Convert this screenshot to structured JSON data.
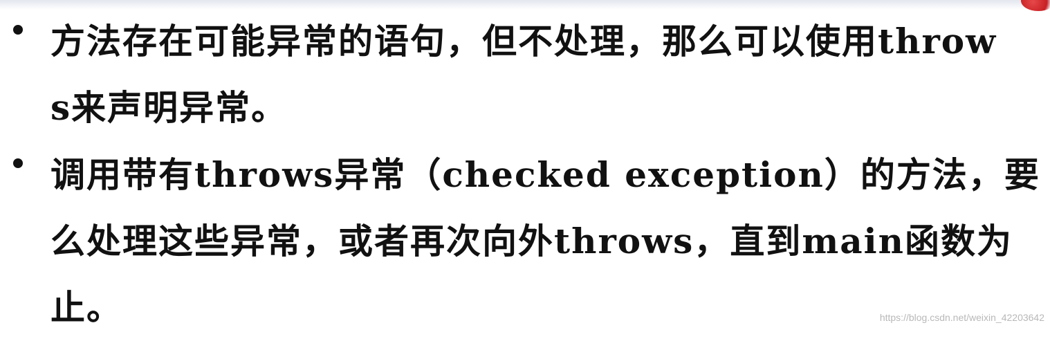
{
  "slide": {
    "bullets": [
      {
        "text": "方法存在可能异常的语句，但不处理，那么可以使用throws来声明异常。"
      },
      {
        "text": "调用带有throws异常（checked exception）的方法，要么处理这些异常，或者再次向外throws，直到main函数为止。"
      }
    ],
    "watermark": "https://blog.csdn.net/weixin_42203642"
  },
  "colors": {
    "text": "#111111",
    "accent": "#c81f24",
    "watermark": "#b4b4b4"
  }
}
